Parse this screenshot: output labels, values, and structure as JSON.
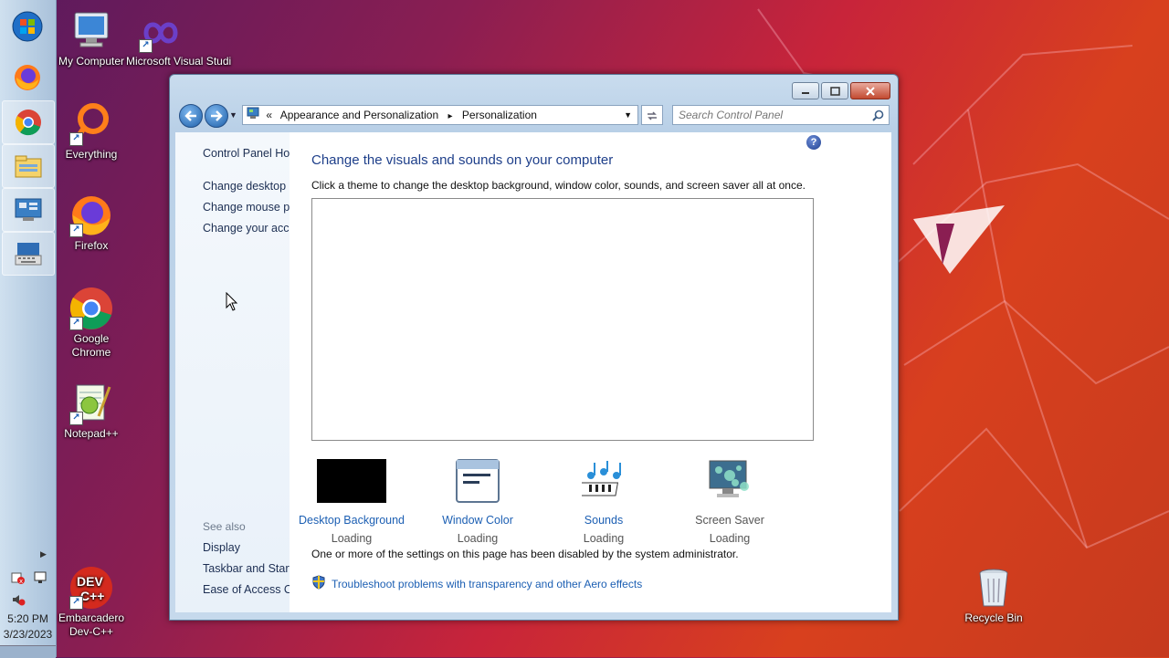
{
  "taskbar": {
    "apps": [
      {
        "name": "start-orb-icon"
      },
      {
        "name": "firefox-icon"
      },
      {
        "name": "chrome-icon"
      },
      {
        "name": "file-explorer-icon"
      },
      {
        "name": "control-panel-icon"
      },
      {
        "name": "keyboard-icon"
      }
    ],
    "time": "5:20 PM",
    "date": "3/23/2023"
  },
  "desktop": {
    "icons": [
      {
        "label": "My Computer",
        "icon": "computer-icon"
      },
      {
        "label": "Microsoft Visual Studi",
        "icon": "visual-studio-icon"
      },
      {
        "label": "Everything",
        "icon": "everything-icon"
      },
      {
        "label": "Firefox",
        "icon": "firefox-icon"
      },
      {
        "label": "Google Chrome",
        "icon": "chrome-icon"
      },
      {
        "label": "Notepad++",
        "icon": "notepadpp-icon"
      },
      {
        "label": "Embarcadero Dev-C++",
        "icon": "devcpp-icon"
      },
      {
        "label": "Recycle Bin",
        "icon": "recycle-bin-icon"
      }
    ]
  },
  "window": {
    "breadcrumb": {
      "prefix": "«",
      "parent": "Appearance and Personalization",
      "separator": "▸",
      "current": "Personalization"
    },
    "search_placeholder": "Search Control Panel",
    "left_pane": {
      "home": "Control Panel Hor",
      "links": [
        "Change desktop ic",
        "Change mouse po",
        "Change your acco"
      ],
      "see_also_title": "See also",
      "see_also": [
        "Display",
        "Taskbar and Start I",
        "Ease of Access Cer"
      ]
    },
    "main": {
      "heading": "Change the visuals and sounds on your computer",
      "subtext": "Click a theme to change the desktop background, window color, sounds, and screen saver all at once.",
      "settings": [
        {
          "label": "Desktop Background",
          "status": "Loading",
          "icon": "desktop-background-icon"
        },
        {
          "label": "Window Color",
          "status": "Loading",
          "icon": "window-color-icon"
        },
        {
          "label": "Sounds",
          "status": "Loading",
          "icon": "sounds-icon"
        },
        {
          "label": "Screen Saver",
          "status": "Loading",
          "icon": "screen-saver-icon"
        }
      ],
      "notice": "One or more of the settings on this page has been disabled by the system administrator.",
      "troubleshoot_link": "Troubleshoot problems with transparency and other Aero effects"
    }
  },
  "colors": {
    "link": "#1c5fb3",
    "heading": "#1e3f8a"
  }
}
